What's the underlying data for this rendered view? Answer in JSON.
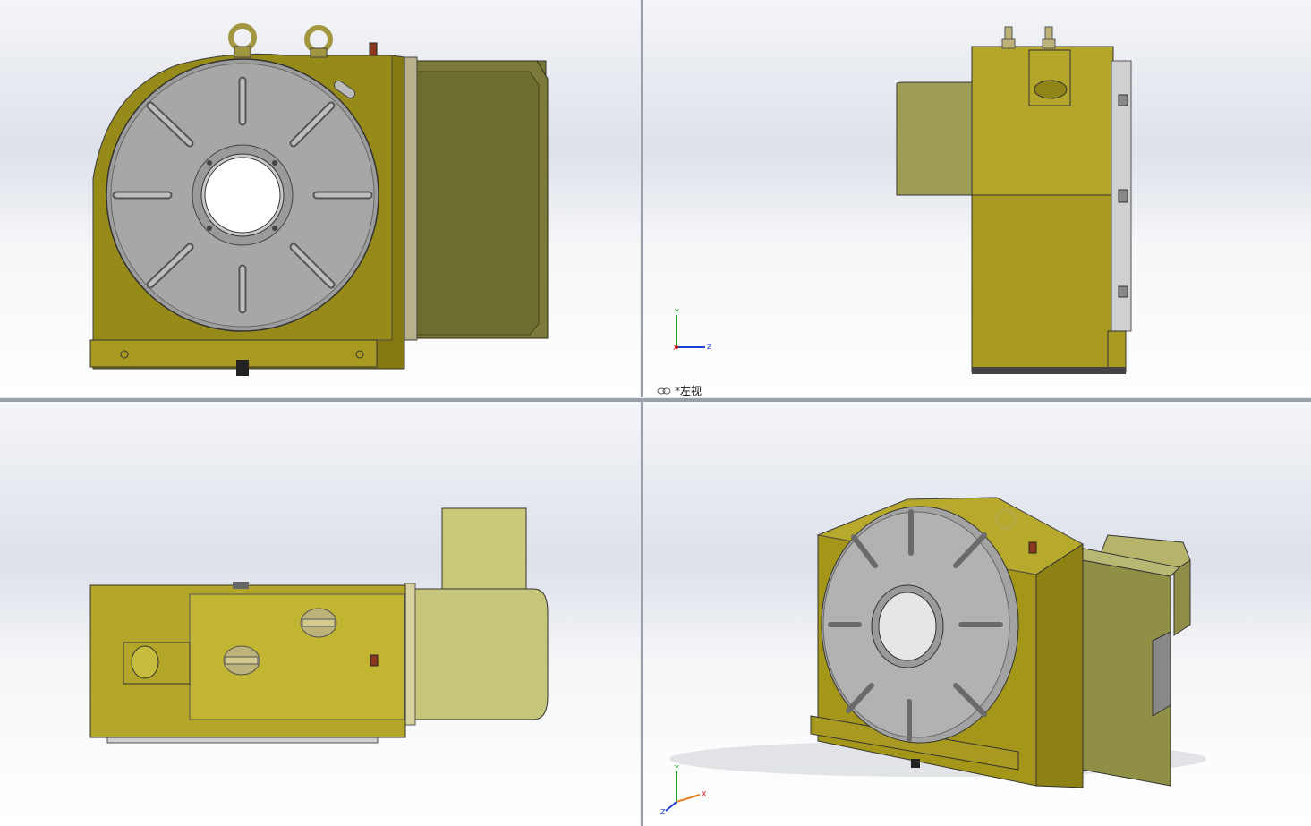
{
  "viewports": {
    "top_left": {
      "name": "front-view"
    },
    "top_right": {
      "name": "left-view",
      "label": "*左视"
    },
    "bottom_left": {
      "name": "top-view"
    },
    "bottom_right": {
      "name": "isometric-view"
    }
  },
  "triad": {
    "x": "X",
    "y": "Y",
    "z": "Z"
  },
  "colors": {
    "body": "#a89a20",
    "body_dark": "#7a6e10",
    "motor": "#7b7a3a",
    "motor_light": "#c5c67a",
    "table": "#a9a9a9",
    "table_dark": "#6f6f6f",
    "triad_x": "#d02020",
    "triad_y": "#20a020",
    "triad_z": "#2040d0"
  }
}
